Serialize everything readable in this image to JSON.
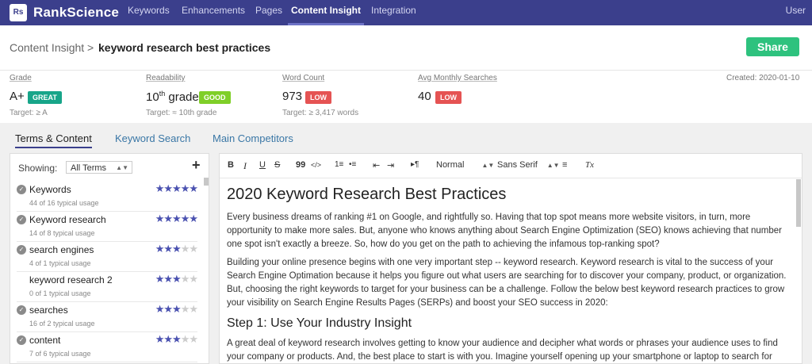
{
  "nav": {
    "logo": "Rs",
    "brand": "RankScience",
    "items": [
      "Keywords",
      "Enhancements",
      "Pages",
      "Content Insight",
      "Integration"
    ],
    "active": "Content Insight",
    "user": "User"
  },
  "header": {
    "crumb": "Content Insight >",
    "title": "keyword research best practices",
    "share": "Share"
  },
  "metrics": {
    "grade": {
      "label": "Grade",
      "value": "A+",
      "badge": "GREAT",
      "target": "Target: ≥ A"
    },
    "readability": {
      "label": "Readability",
      "value_pre": "10",
      "value_sup": "th",
      "value_post": " grade",
      "badge": "GOOD",
      "target": "Target: ≈ 10th grade"
    },
    "wordcount": {
      "label": "Word Count",
      "value": "973",
      "badge": "LOW",
      "target": "Target: ≥ 3,417 words"
    },
    "searches": {
      "label": "Avg Monthly Searches",
      "value": "40",
      "badge": "LOW"
    },
    "created": "Created: 2020-01-10"
  },
  "colors": {
    "great": "#17a589",
    "good": "#7fcf28",
    "low": "#e55353",
    "accent": "#3b3f8c"
  },
  "tabs": [
    "Terms & Content",
    "Keyword Search",
    "Main Competitors"
  ],
  "terms_panel": {
    "showing_label": "Showing:",
    "filter": "All Terms",
    "add_icon": "plus-icon",
    "terms": [
      {
        "name": "Keywords",
        "usage": "44 of 16 typical usage",
        "stars": 5,
        "checked": true
      },
      {
        "name": "Keyword research",
        "usage": "14 of 8 typical usage",
        "stars": 5,
        "checked": true
      },
      {
        "name": "search engines",
        "usage": "4 of 1 typical usage",
        "stars": 3,
        "checked": true
      },
      {
        "name": "keyword research 2",
        "usage": "0 of 1 typical usage",
        "stars": 3,
        "checked": false
      },
      {
        "name": "searches",
        "usage": "16 of 2 typical usage",
        "stars": 3,
        "checked": true
      },
      {
        "name": "content",
        "usage": "7 of 6 typical usage",
        "stars": 3,
        "checked": true
      }
    ]
  },
  "toolbar": {
    "bold": "B",
    "italic": "I",
    "underline": "U",
    "strike": "S",
    "quote": "99",
    "code": "</>",
    "ol": "1≡",
    "ul": "•≡",
    "outdent": "⇤",
    "indent": "⇥",
    "direction": "▸¶",
    "heading": "Normal",
    "font": "Sans Serif",
    "align": "≡",
    "clear": "Tx"
  },
  "document": {
    "title": "2020 Keyword Research Best Practices",
    "p1": "Every business dreams of ranking #1 on Google, and rightfully so. Having that top spot means more website visitors, in turn, more opportunity to make more sales. But, anyone who knows anything about Search Engine Optimization (SEO) knows achieving that number one spot isn't exactly a breeze. So, how do you get on the path to achieving the infamous top-ranking spot?",
    "p2": "Building your online presence begins with one very important step -- keyword research. Keyword research is vital to the success of your Search Engine Optimation because it helps you figure out what users are searching for to discover your company, product, or organization. But, choosing the right keywords to target for your business can be a challenge. Follow the below best keyword research practices to grow your visibility on Search Engine Results Pages (SERPs) and boost your SEO success in 2020:",
    "h2": "Step 1: Use Your Industry Insight",
    "p3": "A great deal of keyword research involves getting to know your audience and decipher what words or phrases your audience uses to find your company or products. And, the best place to start is with you. Imagine yourself opening up your smartphone or laptop to search for your company or product. What would you lookup? How would you try to search for your business?"
  }
}
